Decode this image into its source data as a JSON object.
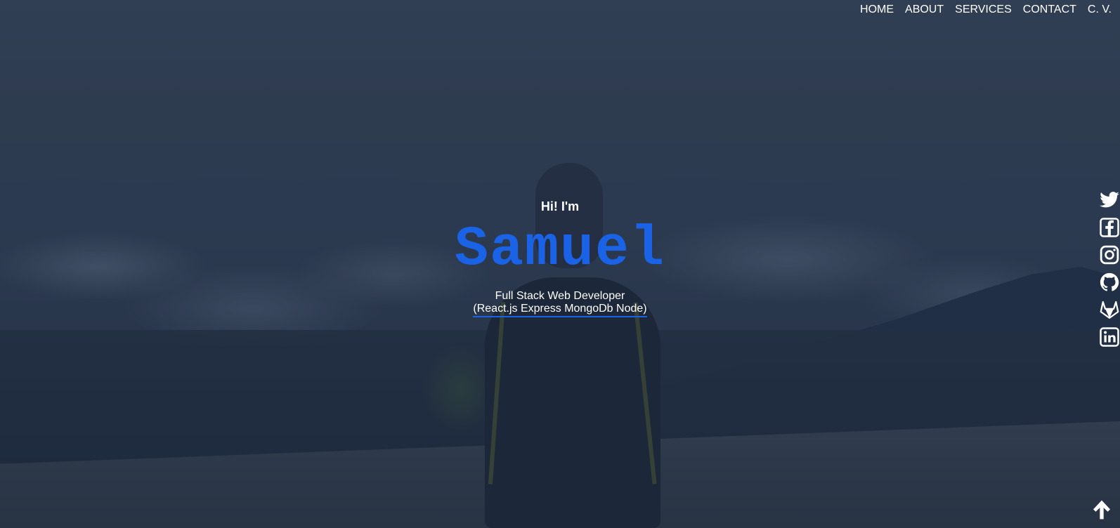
{
  "nav": {
    "items": [
      "HOME",
      "ABOUT",
      "SERVICES",
      "CONTACT",
      "C. V."
    ]
  },
  "hero": {
    "greeting": "Hi! I'm",
    "name": "Samuel",
    "role": "Full Stack Web Developer",
    "stack": "(React.js Express MongoDb Node)"
  },
  "social": {
    "icons": [
      "twitter-icon",
      "facebook-icon",
      "instagram-icon",
      "github-icon",
      "gitlab-icon",
      "linkedin-icon"
    ]
  },
  "scroll_top": {
    "icon": "arrow-up-icon"
  },
  "colors": {
    "accent": "#1a63e6",
    "text": "#ffffff",
    "overlay": "#1c283e"
  }
}
